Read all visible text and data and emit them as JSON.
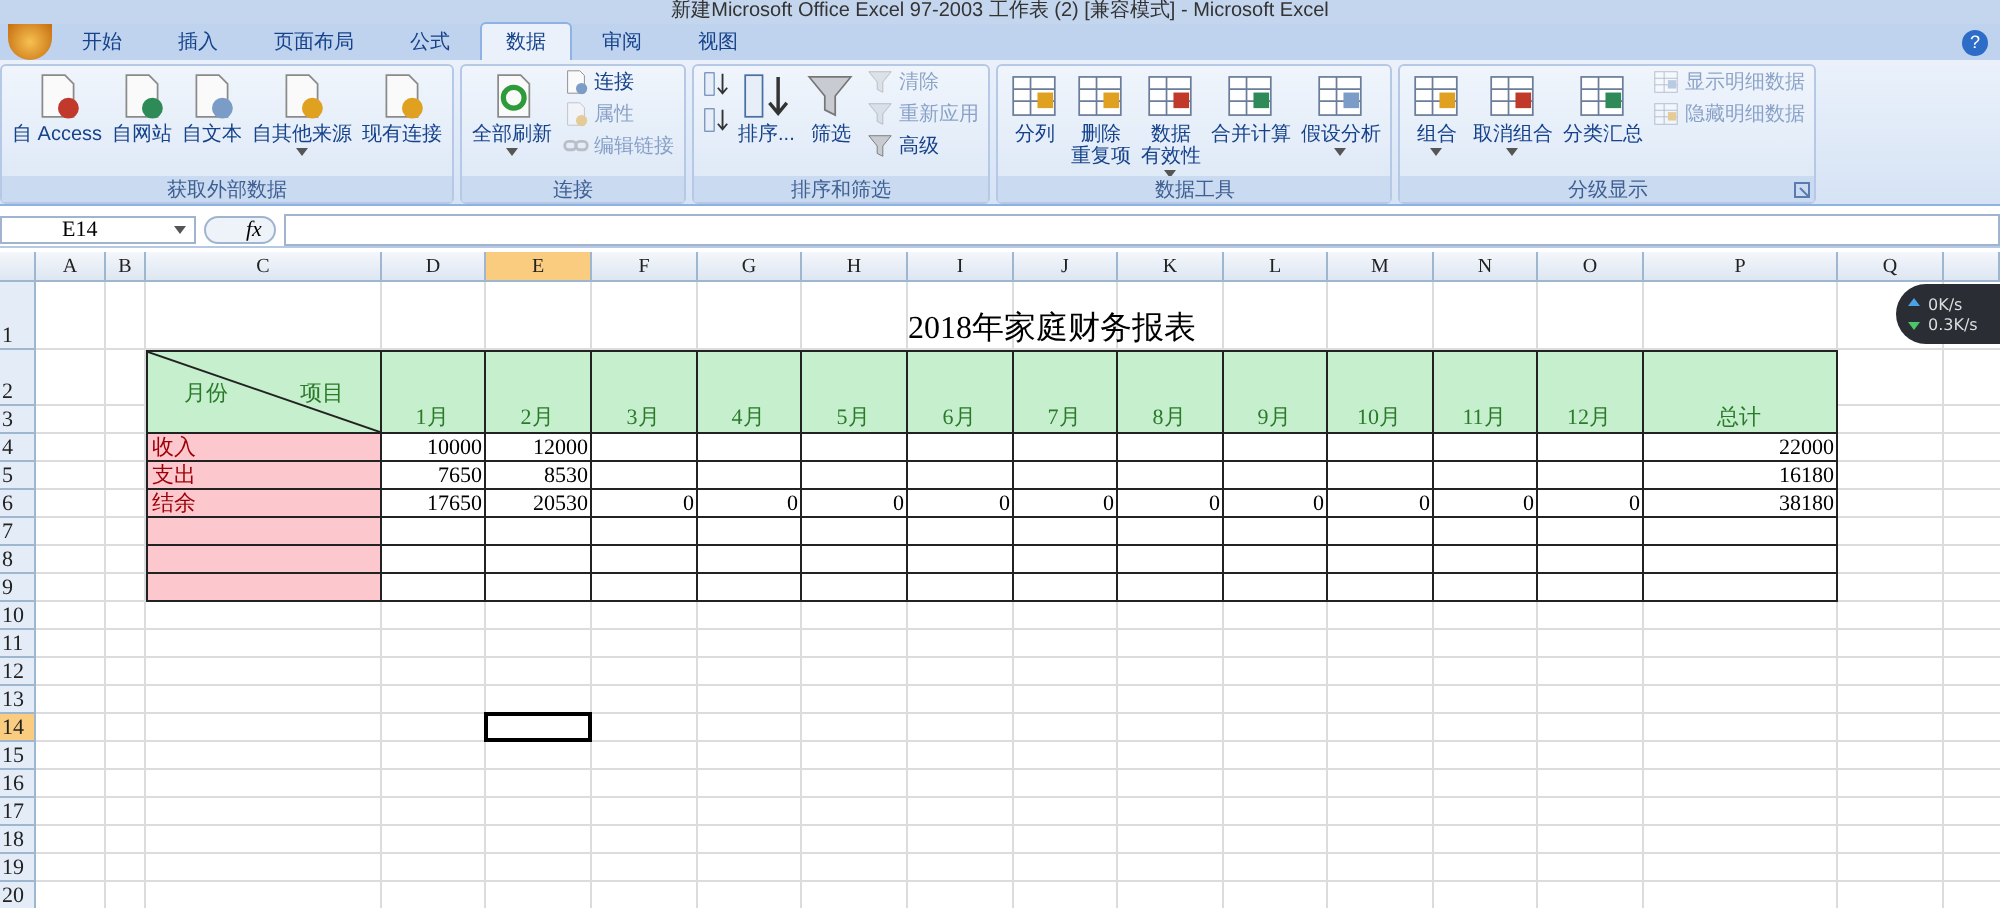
{
  "window": {
    "title": "新建Microsoft Office Excel 97-2003 工作表 (2) [兼容模式] - Microsoft Excel"
  },
  "tabs": [
    {
      "label": "开始",
      "selected": false
    },
    {
      "label": "插入",
      "selected": false
    },
    {
      "label": "页面布局",
      "selected": false
    },
    {
      "label": "公式",
      "selected": false
    },
    {
      "label": "数据",
      "selected": true
    },
    {
      "label": "审阅",
      "selected": false
    },
    {
      "label": "视图",
      "selected": false
    }
  ],
  "help_button": "?",
  "ribbon": [
    {
      "label": "获取外部数据",
      "items": [
        {
          "kind": "large",
          "label": "自 Access",
          "disabled": false
        },
        {
          "kind": "large",
          "label": "自网站",
          "disabled": false
        },
        {
          "kind": "large",
          "label": "自文本",
          "disabled": false
        },
        {
          "kind": "large",
          "label": "自其他来源",
          "disabled": false,
          "dropdown": true
        },
        {
          "kind": "large",
          "label": "现有连接",
          "disabled": false
        }
      ]
    },
    {
      "label": "连接",
      "items": [
        {
          "kind": "large",
          "label": "全部刷新",
          "disabled": false,
          "dropdown": true
        },
        {
          "kind": "small",
          "label": "连接",
          "disabled": false
        },
        {
          "kind": "small",
          "label": "属性",
          "disabled": true
        },
        {
          "kind": "small",
          "label": "编辑链接",
          "disabled": true
        }
      ]
    },
    {
      "label": "排序和筛选",
      "items": [
        {
          "kind": "icon",
          "disabled": false
        },
        {
          "kind": "icon",
          "disabled": false
        },
        {
          "kind": "large",
          "label": "排序...",
          "disabled": false
        },
        {
          "kind": "large",
          "label": "筛选",
          "disabled": false
        },
        {
          "kind": "small",
          "label": "清除",
          "disabled": true
        },
        {
          "kind": "small",
          "label": "重新应用",
          "disabled": true
        },
        {
          "kind": "small",
          "label": "高级",
          "disabled": false
        }
      ]
    },
    {
      "label": "数据工具",
      "items": [
        {
          "kind": "large",
          "label": "分列",
          "disabled": false
        },
        {
          "kind": "large",
          "lines": [
            "删除",
            "重复项"
          ],
          "disabled": false
        },
        {
          "kind": "large",
          "lines": [
            "数据",
            "有效性"
          ],
          "disabled": false,
          "dropdown": true
        },
        {
          "kind": "large",
          "label": "合并计算",
          "disabled": false
        },
        {
          "kind": "large",
          "label": "假设分析",
          "disabled": false,
          "dropdown": true
        }
      ]
    },
    {
      "label": "分级显示",
      "launcher": true,
      "items": [
        {
          "kind": "large",
          "label": "组合",
          "disabled": false,
          "dropdown": true
        },
        {
          "kind": "large",
          "label": "取消组合",
          "disabled": false,
          "dropdown": true
        },
        {
          "kind": "large",
          "label": "分类汇总",
          "disabled": false
        },
        {
          "kind": "small",
          "label": "显示明细数据",
          "disabled": true
        },
        {
          "kind": "small",
          "label": "隐藏明细数据",
          "disabled": true
        }
      ]
    }
  ],
  "formula_bar": {
    "name_box": "E14",
    "function_button": "fx"
  },
  "column_headers": [
    {
      "label": "A",
      "selected": false
    },
    {
      "label": "B",
      "selected": false
    },
    {
      "label": "C",
      "selected": false
    },
    {
      "label": "D",
      "selected": false
    },
    {
      "label": "E",
      "selected": true
    },
    {
      "label": "F",
      "selected": false
    },
    {
      "label": "G",
      "selected": false
    },
    {
      "label": "H",
      "selected": false
    },
    {
      "label": "I",
      "selected": false
    },
    {
      "label": "J",
      "selected": false
    },
    {
      "label": "K",
      "selected": false
    },
    {
      "label": "L",
      "selected": false
    },
    {
      "label": "M",
      "selected": false
    },
    {
      "label": "N",
      "selected": false
    },
    {
      "label": "O",
      "selected": false
    },
    {
      "label": "P",
      "selected": false
    },
    {
      "label": "Q",
      "selected": false
    }
  ],
  "row_headers": [
    {
      "label": "1",
      "selected": false
    },
    {
      "label": "2",
      "selected": false
    },
    {
      "label": "3",
      "selected": false
    },
    {
      "label": "4",
      "selected": false
    },
    {
      "label": "5",
      "selected": false
    },
    {
      "label": "6",
      "selected": false
    },
    {
      "label": "7",
      "selected": false
    },
    {
      "label": "8",
      "selected": false
    },
    {
      "label": "9",
      "selected": false
    },
    {
      "label": "10",
      "selected": false
    },
    {
      "label": "11",
      "selected": false
    },
    {
      "label": "12",
      "selected": false
    },
    {
      "label": "13",
      "selected": false
    },
    {
      "label": "14",
      "selected": true
    },
    {
      "label": "15",
      "selected": false
    },
    {
      "label": "16",
      "selected": false
    },
    {
      "label": "17",
      "selected": false
    },
    {
      "label": "18",
      "selected": false
    },
    {
      "label": "19",
      "selected": false
    },
    {
      "label": "20",
      "selected": false
    }
  ],
  "sheet": {
    "title": "2018年家庭财务报表",
    "corner": {
      "left": "月份",
      "right": "项目"
    },
    "months": [
      "1月",
      "2月",
      "3月",
      "4月",
      "5月",
      "6月",
      "7月",
      "8月",
      "9月",
      "10月",
      "11月",
      "12月"
    ],
    "total_header": "总计",
    "rows": [
      {
        "kind": "data",
        "label": "收入",
        "values": [
          "10000",
          "12000"
        ],
        "total": "22000"
      },
      {
        "kind": "data",
        "label": "支出",
        "values": [
          "7650",
          "8530"
        ],
        "total": "16180"
      },
      {
        "kind": "data",
        "label": "结余",
        "values": [
          "17650",
          "20530",
          "0",
          "0",
          "0",
          "0",
          "0",
          "0",
          "0",
          "0",
          "0",
          "0"
        ],
        "total": "38180"
      },
      {
        "kind": "blank"
      },
      {
        "kind": "blank"
      },
      {
        "kind": "blank"
      }
    ]
  },
  "net_speed": {
    "upload": "0K/s",
    "download": "0.3K/s"
  }
}
